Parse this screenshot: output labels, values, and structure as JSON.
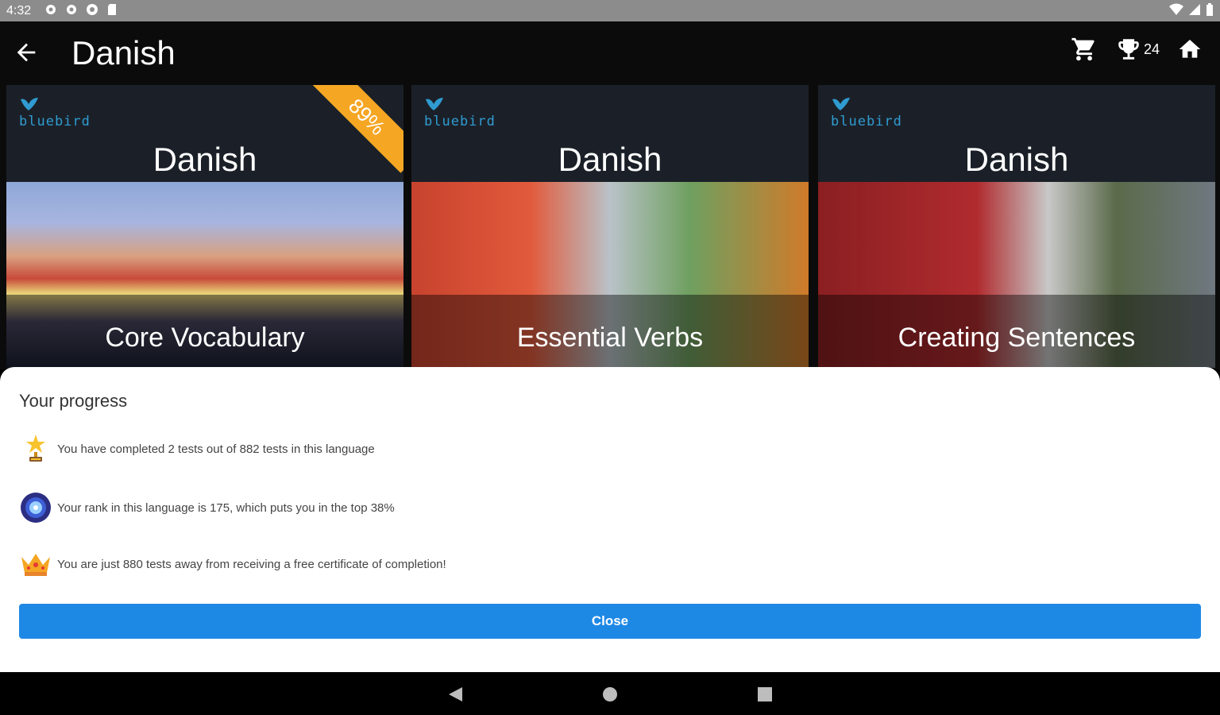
{
  "status_bar": {
    "time": "4:32"
  },
  "app_bar": {
    "title": "Danish",
    "trophy_count": "24"
  },
  "cards": [
    {
      "brand": "bluebird",
      "language": "Danish",
      "caption": "Core Vocabulary",
      "ribbon": "89%"
    },
    {
      "brand": "bluebird",
      "language": "Danish",
      "caption": "Essential Verbs"
    },
    {
      "brand": "bluebird",
      "language": "Danish",
      "caption": "Creating Sentences"
    }
  ],
  "progress": {
    "title": "Your progress",
    "rows": [
      {
        "icon": "trophy-star-icon",
        "text": "You have completed 2 tests out of 882 tests in this language"
      },
      {
        "icon": "rank-medal-icon",
        "text": "Your rank in this language is 175, which puts you in the top 38%"
      },
      {
        "icon": "crown-icon",
        "text": "You are just 880 tests away from receiving a free certificate of completion!"
      }
    ],
    "close_label": "Close"
  },
  "colors": {
    "accent": "#1e88e5",
    "ribbon": "#f5a623",
    "brand": "#2f9bd1"
  }
}
